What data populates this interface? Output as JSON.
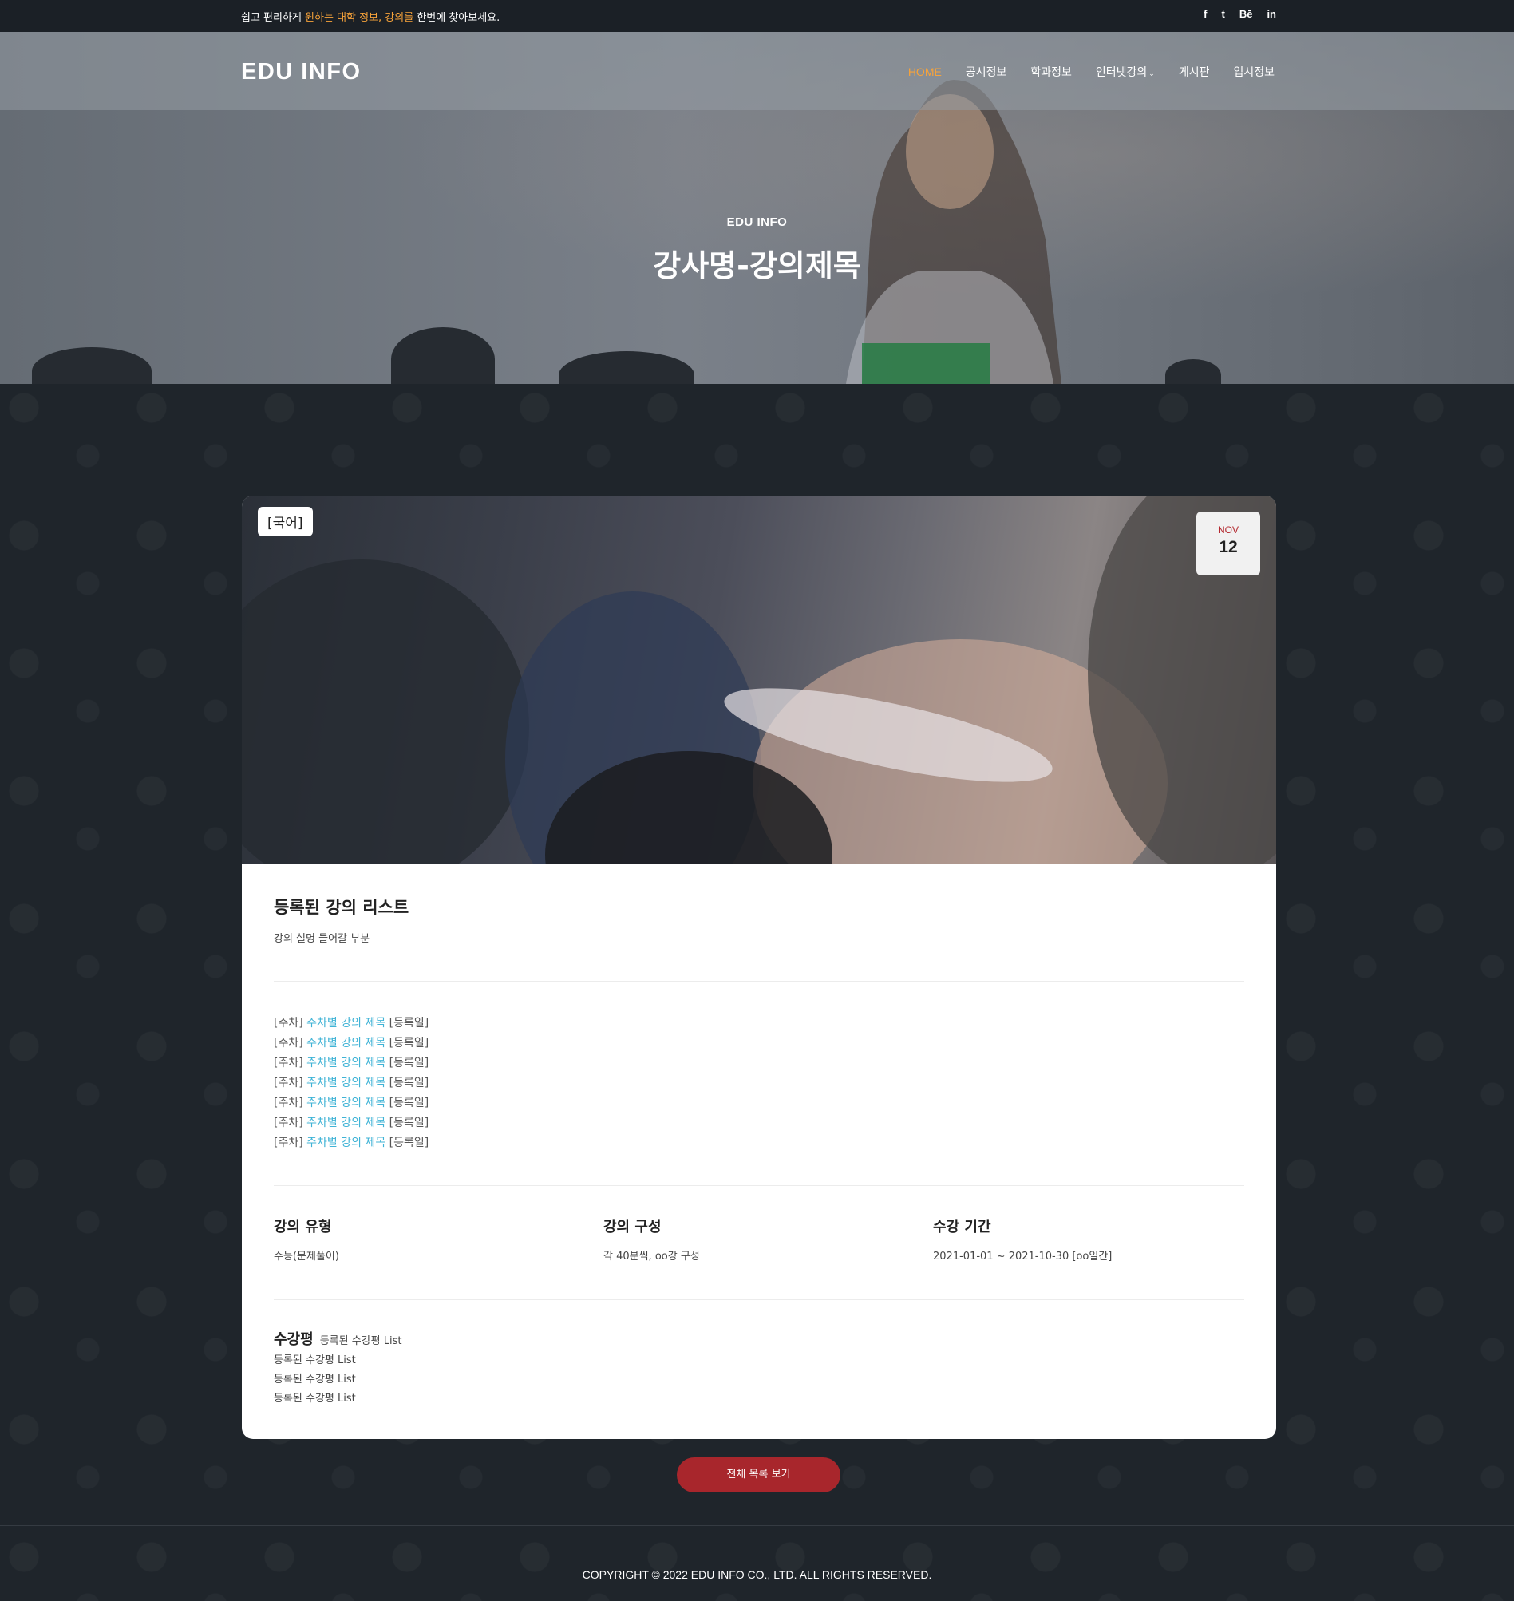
{
  "topbar": {
    "msg_pre": "쉽고 편리하게 ",
    "msg_hl1": "원하는 대학 정보,",
    "msg_mid": " ",
    "msg_hl2": "강의를",
    "msg_post": " 한번에 찾아보세요.",
    "social": [
      "f",
      "t",
      "Bē",
      "in"
    ]
  },
  "nav": {
    "logo": "EDU INFO",
    "items": [
      "HOME",
      "공시정보",
      "학과정보",
      "인터넷강의",
      "게시판",
      "입시정보"
    ],
    "caret": "⌄"
  },
  "hero": {
    "sub": "EDU INFO",
    "title": "강사명-강의제목"
  },
  "card": {
    "tag": "[국어]",
    "date_month": "NOV",
    "date_day": "12",
    "list_title": "등록된 강의 리스트",
    "description": "강의 설명 들어갈 부분",
    "lessons": [
      {
        "pre": "[주차] ",
        "link": "주차별 강의 제목",
        "post": " [등록일]"
      },
      {
        "pre": "[주차] ",
        "link": "주차별 강의 제목",
        "post": " [등록일]"
      },
      {
        "pre": "[주차] ",
        "link": "주차별 강의 제목",
        "post": " [등록일]"
      },
      {
        "pre": "[주차] ",
        "link": "주차별 강의 제목",
        "post": " [등록일]"
      },
      {
        "pre": "[주차] ",
        "link": "주차별 강의 제목",
        "post": " [등록일]"
      },
      {
        "pre": "[주차] ",
        "link": "주차별 강의 제목",
        "post": " [등록일]"
      },
      {
        "pre": "[주차] ",
        "link": "주차별 강의 제목",
        "post": " [등록일]"
      }
    ],
    "type_label": "강의 유형",
    "type_value": "수능(문제풀이)",
    "composition_label": "강의 구성",
    "composition_value": "각 40분씩, oo강 구성",
    "period_label": "수강 기간",
    "period_value": "2021-01-01 ~ 2021-10-30 [oo일간]",
    "reviews_label": "수강평",
    "reviews": [
      "등록된 수강평 List",
      "등록된 수강평 List",
      "등록된 수강평 List",
      "등록된 수강평 List"
    ]
  },
  "button": {
    "view_all": "전체 목록 보기"
  },
  "footer": {
    "copyright": "COPYRIGHT © 2022 EDU INFO CO., LTD. ALL RIGHTS RESERVED."
  },
  "colors": {
    "accent": "#f7a33a",
    "link": "#3fb3d6",
    "button": "#a8262c",
    "background": "#1f252b"
  }
}
